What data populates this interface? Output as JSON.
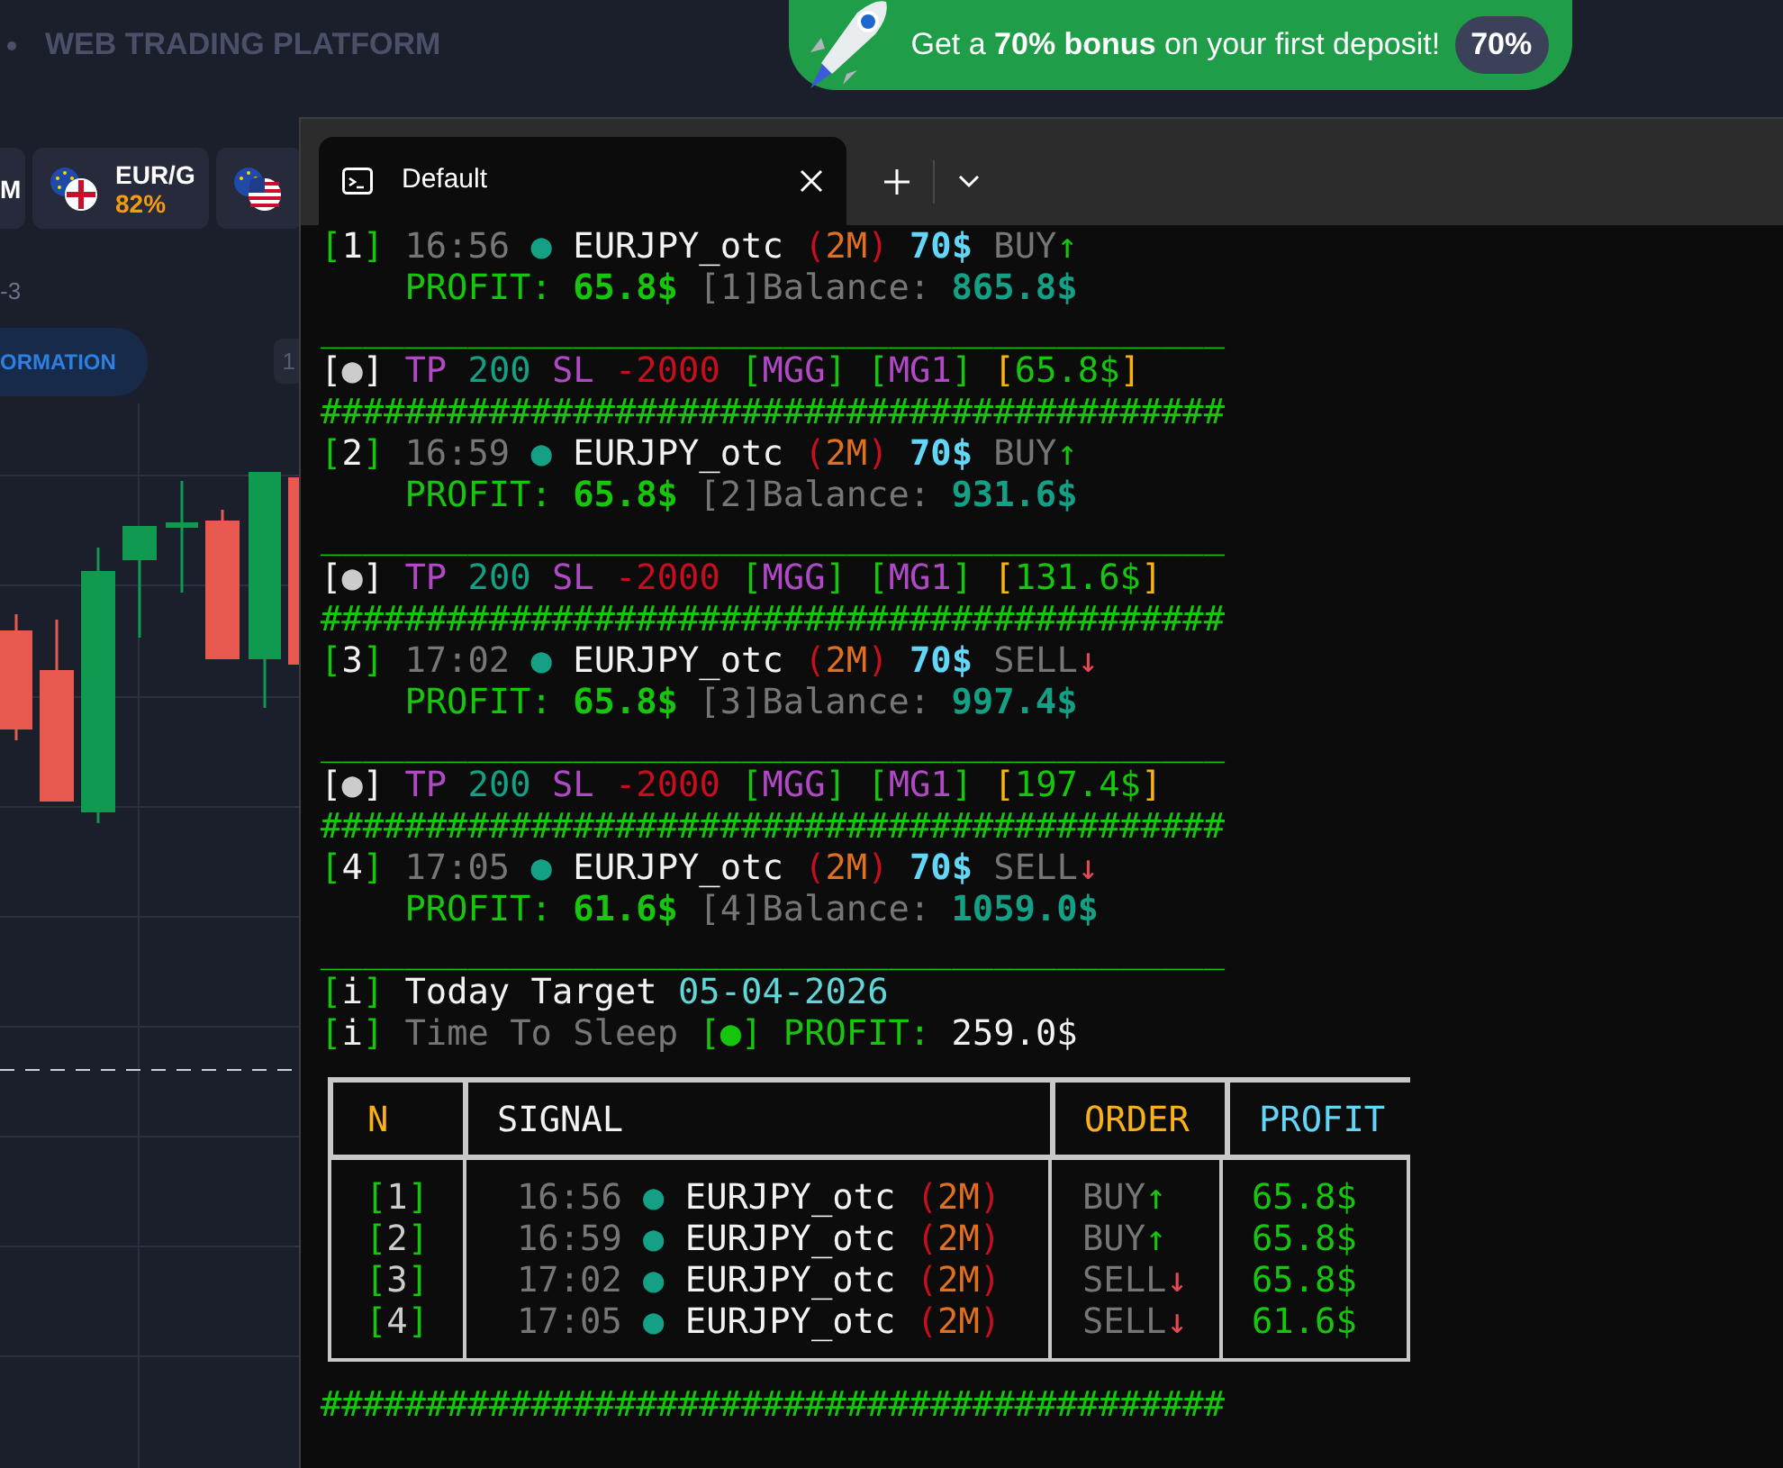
{
  "platform": {
    "title": "WEB TRADING PLATFORM",
    "promo": {
      "text": "Get a **70% bonus** on your first deposit!",
      "badge": "70%"
    },
    "assets": [
      {
        "kind": "cut",
        "label": "M"
      },
      {
        "kind": "pair",
        "label": "EUR/G",
        "payout": "82%"
      },
      {
        "kind": "flags"
      }
    ],
    "chart": {
      "label": "-3",
      "pill": "ORMATION",
      "tag": "1"
    }
  },
  "terminal": {
    "tabs": [
      {
        "title": "Default",
        "selected": true
      }
    ],
    "output_lines": [
      {
        "kind": "plain",
        "segments": [
          {
            "text": "[",
            "color": "#16c60c"
          },
          {
            "text": "1",
            "color": "#f2f2f2"
          },
          {
            "text": "] ",
            "color": "#16c60c"
          },
          {
            "text": "16:56 ",
            "color": "#767676"
          },
          {
            "text": "● ",
            "color": "#13a085"
          },
          {
            "text": "EURJPY_otc ",
            "color": "#f2f2f2"
          },
          {
            "text": "(",
            "color": "#c50f1f"
          },
          {
            "text": "2M",
            "color": "#e0701f"
          },
          {
            "text": ") ",
            "color": "#c50f1f"
          },
          {
            "text": "70$ ",
            "color": "#61d6f6",
            "bold": true
          },
          {
            "text": "BUY",
            "color": "#767676"
          },
          {
            "text": "↑",
            "color": "#16c60c"
          }
        ]
      },
      {
        "kind": "indented",
        "segments": [
          {
            "text": "PROFIT: ",
            "color": "#16c60c"
          },
          {
            "text": "65.8$ ",
            "color": "#16c60c",
            "bold": true
          },
          {
            "text": "[1]Balance: ",
            "color": "#767676"
          },
          {
            "text": "865.8$",
            "color": "#13a085",
            "bold": true
          }
        ]
      },
      {
        "kind": "plain",
        "segments": [
          {
            "text": "___________________________________________",
            "color": "#16c60c"
          }
        ]
      },
      {
        "kind": "plain",
        "segments": [
          {
            "text": "[",
            "color": "#f2f2f2"
          },
          {
            "text": "●",
            "color": "#cccccc"
          },
          {
            "text": "] ",
            "color": "#f2f2f2"
          },
          {
            "text": "TP ",
            "color": "#b148c6"
          },
          {
            "text": "200 ",
            "color": "#13a085"
          },
          {
            "text": "SL ",
            "color": "#b148c6"
          },
          {
            "text": "-2000 ",
            "color": "#c50f1f"
          },
          {
            "text": "[",
            "color": "#16c60c"
          },
          {
            "text": "MGG",
            "color": "#b148c6"
          },
          {
            "text": "] ",
            "color": "#16c60c"
          },
          {
            "text": "[",
            "color": "#16c60c"
          },
          {
            "text": "MG1",
            "color": "#b148c6"
          },
          {
            "text": "] ",
            "color": "#16c60c"
          },
          {
            "text": "[",
            "color": "#f9b116"
          },
          {
            "text": "65.8$",
            "color": "#16c60c"
          },
          {
            "text": "]",
            "color": "#f9b116"
          }
        ]
      },
      {
        "kind": "plain",
        "segments": [
          {
            "text": "###########################################",
            "color": "#16c60c"
          }
        ]
      },
      {
        "kind": "plain",
        "segments": [
          {
            "text": "[",
            "color": "#16c60c"
          },
          {
            "text": "2",
            "color": "#f2f2f2"
          },
          {
            "text": "] ",
            "color": "#16c60c"
          },
          {
            "text": "16:59 ",
            "color": "#767676"
          },
          {
            "text": "● ",
            "color": "#13a085"
          },
          {
            "text": "EURJPY_otc ",
            "color": "#f2f2f2"
          },
          {
            "text": "(",
            "color": "#c50f1f"
          },
          {
            "text": "2M",
            "color": "#e0701f"
          },
          {
            "text": ") ",
            "color": "#c50f1f"
          },
          {
            "text": "70$ ",
            "color": "#61d6f6",
            "bold": true
          },
          {
            "text": "BUY",
            "color": "#767676"
          },
          {
            "text": "↑",
            "color": "#16c60c"
          }
        ]
      },
      {
        "kind": "indented",
        "segments": [
          {
            "text": "PROFIT: ",
            "color": "#16c60c"
          },
          {
            "text": "65.8$ ",
            "color": "#16c60c",
            "bold": true
          },
          {
            "text": "[2]Balance: ",
            "color": "#767676"
          },
          {
            "text": "931.6$",
            "color": "#13a085",
            "bold": true
          }
        ]
      },
      {
        "kind": "plain",
        "segments": [
          {
            "text": "___________________________________________",
            "color": "#16c60c"
          }
        ]
      },
      {
        "kind": "plain",
        "segments": [
          {
            "text": "[",
            "color": "#f2f2f2"
          },
          {
            "text": "●",
            "color": "#cccccc"
          },
          {
            "text": "] ",
            "color": "#f2f2f2"
          },
          {
            "text": "TP ",
            "color": "#b148c6"
          },
          {
            "text": "200 ",
            "color": "#13a085"
          },
          {
            "text": "SL ",
            "color": "#b148c6"
          },
          {
            "text": "-2000 ",
            "color": "#c50f1f"
          },
          {
            "text": "[",
            "color": "#16c60c"
          },
          {
            "text": "MGG",
            "color": "#b148c6"
          },
          {
            "text": "] ",
            "color": "#16c60c"
          },
          {
            "text": "[",
            "color": "#16c60c"
          },
          {
            "text": "MG1",
            "color": "#b148c6"
          },
          {
            "text": "] ",
            "color": "#16c60c"
          },
          {
            "text": "[",
            "color": "#f9b116"
          },
          {
            "text": "131.6$",
            "color": "#16c60c"
          },
          {
            "text": "]",
            "color": "#f9b116"
          }
        ]
      },
      {
        "kind": "plain",
        "segments": [
          {
            "text": "###########################################",
            "color": "#16c60c"
          }
        ]
      },
      {
        "kind": "plain",
        "segments": [
          {
            "text": "[",
            "color": "#16c60c"
          },
          {
            "text": "3",
            "color": "#f2f2f2"
          },
          {
            "text": "] ",
            "color": "#16c60c"
          },
          {
            "text": "17:02 ",
            "color": "#767676"
          },
          {
            "text": "● ",
            "color": "#13a085"
          },
          {
            "text": "EURJPY_otc ",
            "color": "#f2f2f2"
          },
          {
            "text": "(",
            "color": "#c50f1f"
          },
          {
            "text": "2M",
            "color": "#e0701f"
          },
          {
            "text": ") ",
            "color": "#c50f1f"
          },
          {
            "text": "70$ ",
            "color": "#61d6f6",
            "bold": true
          },
          {
            "text": "SELL",
            "color": "#767676"
          },
          {
            "text": "↓",
            "color": "#e74856"
          }
        ]
      },
      {
        "kind": "indented",
        "segments": [
          {
            "text": "PROFIT: ",
            "color": "#16c60c"
          },
          {
            "text": "65.8$ ",
            "color": "#16c60c",
            "bold": true
          },
          {
            "text": "[3]Balance: ",
            "color": "#767676"
          },
          {
            "text": "997.4$",
            "color": "#13a085",
            "bold": true
          }
        ]
      },
      {
        "kind": "plain",
        "segments": [
          {
            "text": "___________________________________________",
            "color": "#16c60c"
          }
        ]
      },
      {
        "kind": "plain",
        "segments": [
          {
            "text": "[",
            "color": "#f2f2f2"
          },
          {
            "text": "●",
            "color": "#cccccc"
          },
          {
            "text": "] ",
            "color": "#f2f2f2"
          },
          {
            "text": "TP ",
            "color": "#b148c6"
          },
          {
            "text": "200 ",
            "color": "#13a085"
          },
          {
            "text": "SL ",
            "color": "#b148c6"
          },
          {
            "text": "-2000 ",
            "color": "#c50f1f"
          },
          {
            "text": "[",
            "color": "#16c60c"
          },
          {
            "text": "MGG",
            "color": "#b148c6"
          },
          {
            "text": "] ",
            "color": "#16c60c"
          },
          {
            "text": "[",
            "color": "#16c60c"
          },
          {
            "text": "MG1",
            "color": "#b148c6"
          },
          {
            "text": "] ",
            "color": "#16c60c"
          },
          {
            "text": "[",
            "color": "#f9b116"
          },
          {
            "text": "197.4$",
            "color": "#16c60c"
          },
          {
            "text": "]",
            "color": "#f9b116"
          }
        ]
      },
      {
        "kind": "plain",
        "segments": [
          {
            "text": "###########################################",
            "color": "#16c60c"
          }
        ]
      },
      {
        "kind": "plain",
        "segments": [
          {
            "text": "[",
            "color": "#16c60c"
          },
          {
            "text": "4",
            "color": "#f2f2f2"
          },
          {
            "text": "] ",
            "color": "#16c60c"
          },
          {
            "text": "17:05 ",
            "color": "#767676"
          },
          {
            "text": "● ",
            "color": "#13a085"
          },
          {
            "text": "EURJPY_otc ",
            "color": "#f2f2f2"
          },
          {
            "text": "(",
            "color": "#c50f1f"
          },
          {
            "text": "2M",
            "color": "#e0701f"
          },
          {
            "text": ") ",
            "color": "#c50f1f"
          },
          {
            "text": "70$ ",
            "color": "#61d6f6",
            "bold": true
          },
          {
            "text": "SELL",
            "color": "#767676"
          },
          {
            "text": "↓",
            "color": "#e74856"
          }
        ]
      },
      {
        "kind": "indented",
        "segments": [
          {
            "text": "PROFIT: ",
            "color": "#16c60c"
          },
          {
            "text": "61.6$ ",
            "color": "#16c60c",
            "bold": true
          },
          {
            "text": "[4]Balance: ",
            "color": "#767676"
          },
          {
            "text": "1059.0$",
            "color": "#13a085",
            "bold": true
          }
        ]
      },
      {
        "kind": "plain",
        "segments": [
          {
            "text": "___________________________________________",
            "color": "#16c60c"
          }
        ]
      },
      {
        "kind": "plain",
        "segments": [
          {
            "text": "[",
            "color": "#16c60c"
          },
          {
            "text": "i",
            "color": "#f2f2f2"
          },
          {
            "text": "] ",
            "color": "#16c60c"
          },
          {
            "text": "Today Target ",
            "color": "#f2f2f2"
          },
          {
            "text": "05-04-2026",
            "color": "#61d6d6"
          }
        ]
      },
      {
        "kind": "plain",
        "segments": [
          {
            "text": "[",
            "color": "#16c60c"
          },
          {
            "text": "i",
            "color": "#f2f2f2"
          },
          {
            "text": "] ",
            "color": "#16c60c"
          },
          {
            "text": "Time To Sleep ",
            "color": "#767676"
          },
          {
            "text": "[●] ",
            "color": "#16c60c"
          },
          {
            "text": "PROFIT: ",
            "color": "#16c60c"
          },
          {
            "text": "259.0$",
            "color": "#f2f2f2"
          }
        ]
      }
    ],
    "summary_table": {
      "columns": [
        {
          "label": "N",
          "color": "#f9b116"
        },
        {
          "label": "SIGNAL",
          "color": "#f2f2f2"
        },
        {
          "label": "ORDER",
          "color": "#f9b116"
        },
        {
          "label": "PROFIT",
          "color": "#61d6f6"
        }
      ],
      "rows": [
        {
          "cells": [
            [
              {
                "text": "[",
                "color": "#16c60c"
              },
              {
                "text": "1",
                "color": "#cccccc"
              },
              {
                "text": "]",
                "color": "#16c60c"
              }
            ],
            [
              {
                "text": "16:56 ",
                "color": "#767676"
              },
              {
                "text": "● ",
                "color": "#13a085"
              },
              {
                "text": "EURJPY_otc ",
                "color": "#f2f2f2"
              },
              {
                "text": "(",
                "color": "#c50f1f"
              },
              {
                "text": "2M",
                "color": "#e0701f"
              },
              {
                "text": ")",
                "color": "#c50f1f"
              }
            ],
            [
              {
                "text": "BUY",
                "color": "#767676"
              },
              {
                "text": "↑",
                "color": "#16c60c"
              }
            ],
            [
              {
                "text": "65.8$",
                "color": "#16c60c"
              }
            ]
          ]
        },
        {
          "cells": [
            [
              {
                "text": "[",
                "color": "#16c60c"
              },
              {
                "text": "2",
                "color": "#cccccc"
              },
              {
                "text": "]",
                "color": "#16c60c"
              }
            ],
            [
              {
                "text": "16:59 ",
                "color": "#767676"
              },
              {
                "text": "● ",
                "color": "#13a085"
              },
              {
                "text": "EURJPY_otc ",
                "color": "#f2f2f2"
              },
              {
                "text": "(",
                "color": "#c50f1f"
              },
              {
                "text": "2M",
                "color": "#e0701f"
              },
              {
                "text": ")",
                "color": "#c50f1f"
              }
            ],
            [
              {
                "text": "BUY",
                "color": "#767676"
              },
              {
                "text": "↑",
                "color": "#16c60c"
              }
            ],
            [
              {
                "text": "65.8$",
                "color": "#16c60c"
              }
            ]
          ]
        },
        {
          "cells": [
            [
              {
                "text": "[",
                "color": "#16c60c"
              },
              {
                "text": "3",
                "color": "#cccccc"
              },
              {
                "text": "]",
                "color": "#16c60c"
              }
            ],
            [
              {
                "text": "17:02 ",
                "color": "#767676"
              },
              {
                "text": "● ",
                "color": "#13a085"
              },
              {
                "text": "EURJPY_otc ",
                "color": "#f2f2f2"
              },
              {
                "text": "(",
                "color": "#c50f1f"
              },
              {
                "text": "2M",
                "color": "#e0701f"
              },
              {
                "text": ")",
                "color": "#c50f1f"
              }
            ],
            [
              {
                "text": "SELL",
                "color": "#767676"
              },
              {
                "text": "↓",
                "color": "#e74856"
              }
            ],
            [
              {
                "text": "65.8$",
                "color": "#16c60c"
              }
            ]
          ]
        },
        {
          "cells": [
            [
              {
                "text": "[",
                "color": "#16c60c"
              },
              {
                "text": "4",
                "color": "#cccccc"
              },
              {
                "text": "]",
                "color": "#16c60c"
              }
            ],
            [
              {
                "text": "17:05 ",
                "color": "#767676"
              },
              {
                "text": "● ",
                "color": "#13a085"
              },
              {
                "text": "EURJPY_otc ",
                "color": "#f2f2f2"
              },
              {
                "text": "(",
                "color": "#c50f1f"
              },
              {
                "text": "2M",
                "color": "#e0701f"
              },
              {
                "text": ")",
                "color": "#c50f1f"
              }
            ],
            [
              {
                "text": "SELL",
                "color": "#767676"
              },
              {
                "text": "↓",
                "color": "#e74856"
              }
            ],
            [
              {
                "text": "61.6$",
                "color": "#16c60c"
              }
            ]
          ]
        }
      ]
    },
    "footer_lines": [
      {
        "kind": "plain",
        "segments": [
          {
            "text": "###########################################",
            "color": "#16c60c"
          }
        ]
      }
    ]
  }
}
